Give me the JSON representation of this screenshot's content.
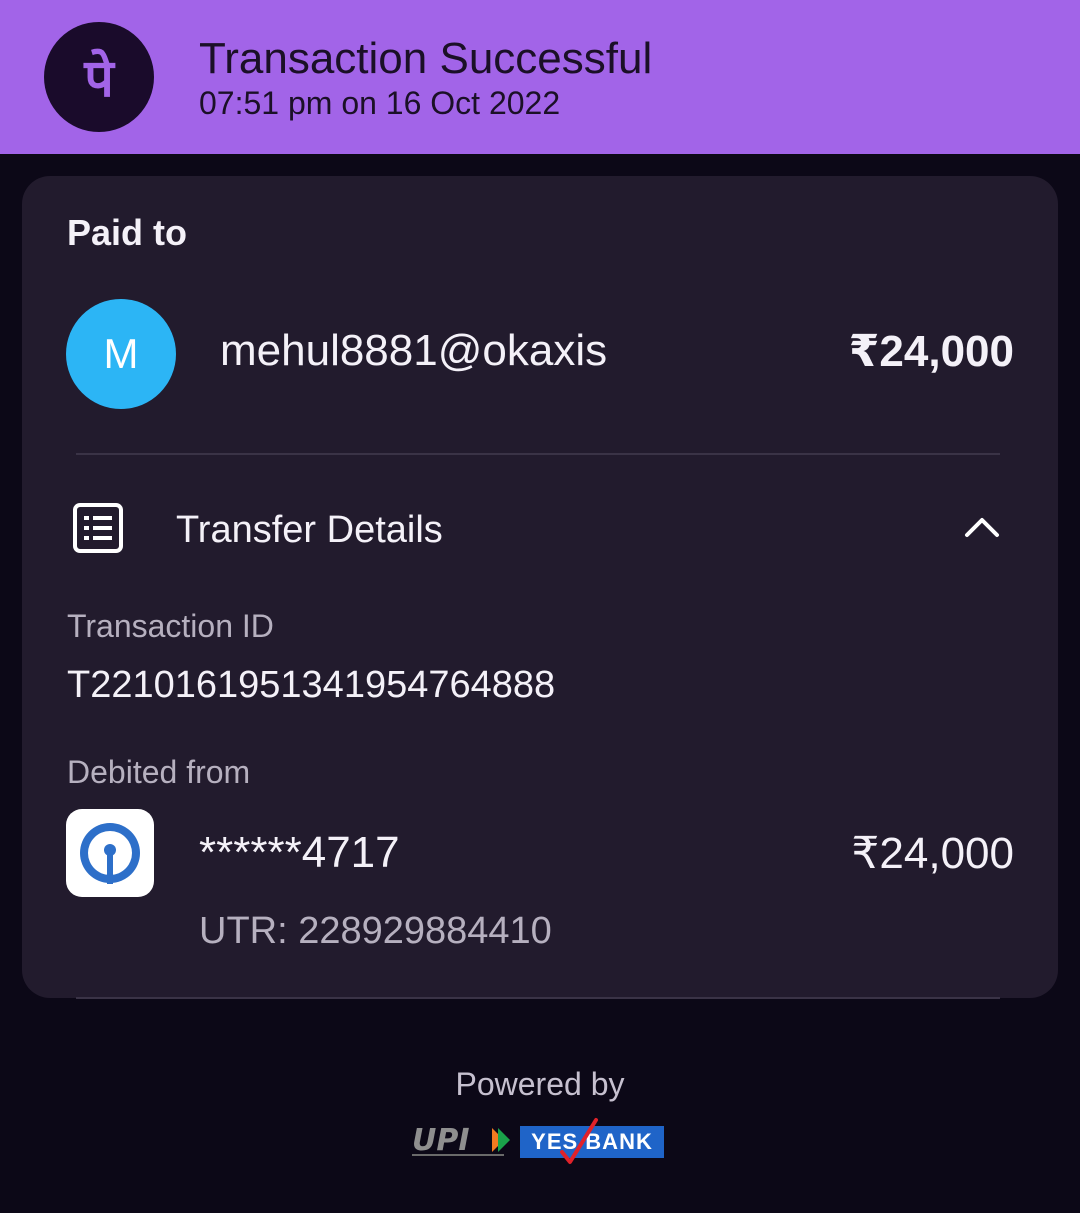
{
  "header": {
    "title": "Transaction Successful",
    "timestamp": "07:51 pm on 16 Oct 2022",
    "background_color": "#a264e8",
    "logo_icon": "phonepe-logo-icon",
    "logo_glyph": "पे"
  },
  "paid_to": {
    "heading": "Paid to",
    "avatar_letter": "M",
    "avatar_color": "#2cb5f5",
    "payee": "mehul8881@okaxis",
    "amount": "₹24,000"
  },
  "transfer_details": {
    "label": "Transfer Details",
    "icon": "receipt-list-icon",
    "toggle_icon": "chevron-up-icon",
    "transaction_id_label": "Transaction ID",
    "transaction_id": "T2210161951341954764888",
    "debited_from_label": "Debited from",
    "bank_icon": "sbi-bank-logo-icon",
    "account": "******4717",
    "amount": "₹24,000",
    "utr": "UTR: 228929884410"
  },
  "footer": {
    "powered_by": "Powered by",
    "upi_logo": "UPI",
    "yes_bank_logo": "YES BANK"
  }
}
